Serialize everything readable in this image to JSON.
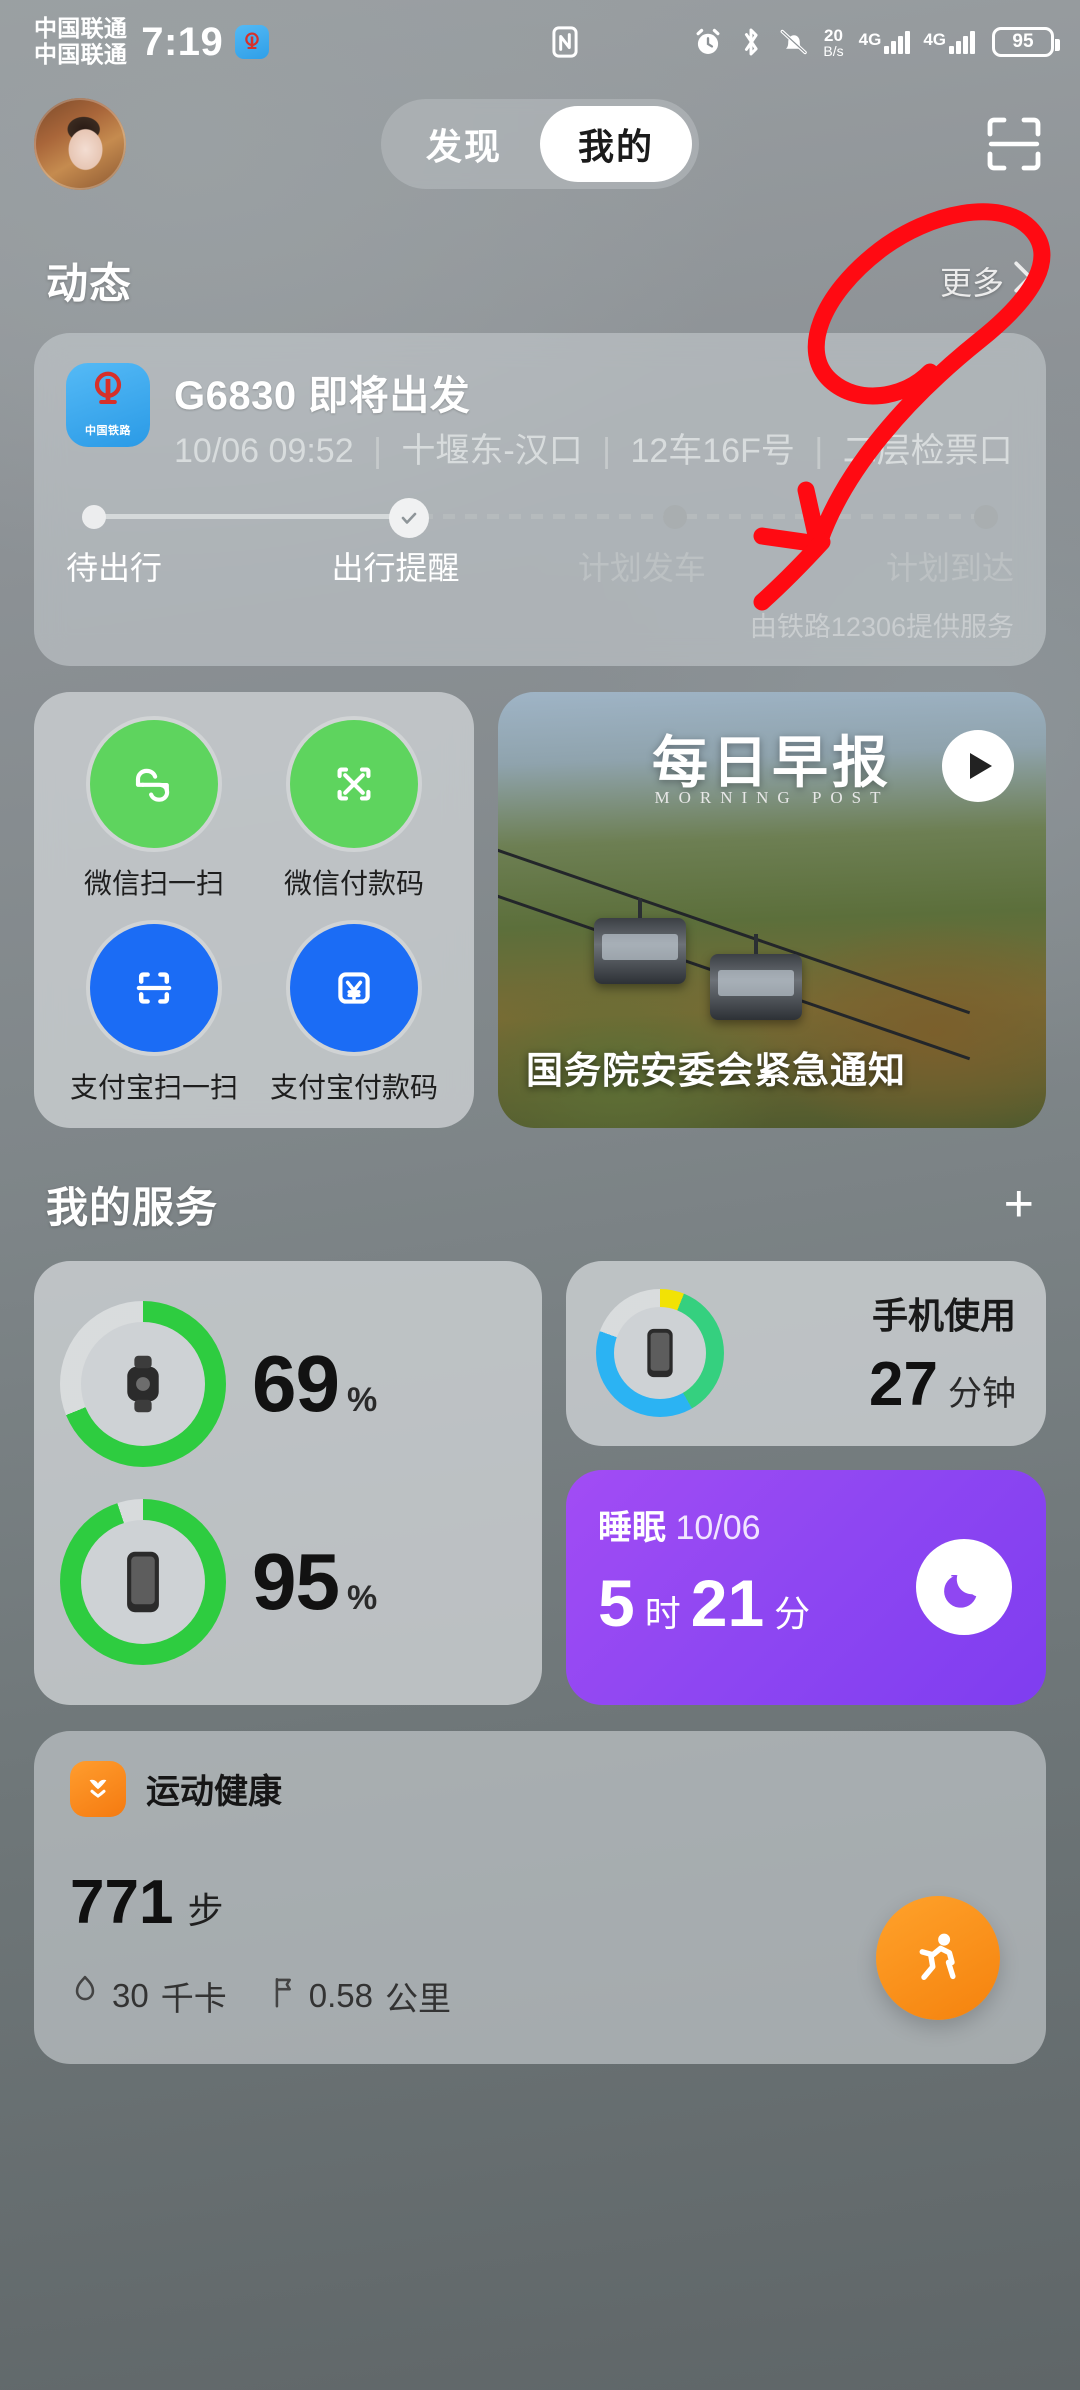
{
  "status_bar": {
    "carrier_line1": "中国联通",
    "carrier_line2": "中国联通",
    "time": "7:19",
    "app_badge_icon": "railway-12306-icon",
    "nfc_icon": "nfc-icon",
    "alarm_icon": "alarm-icon",
    "bluetooth_icon": "bluetooth-icon",
    "mute_icon": "bell-muted-icon",
    "net_speed_value": "20",
    "net_speed_unit": "B/s",
    "network_1": "4G",
    "network_2": "4G",
    "battery_level": "95"
  },
  "top_bar": {
    "avatar_name": "user-avatar",
    "tabs": [
      {
        "label": "发现",
        "active": false
      },
      {
        "label": "我的",
        "active": true
      }
    ],
    "scan_button_icon": "scan-frame-icon"
  },
  "activity": {
    "title": "动态",
    "more_label": "更多",
    "more_chevron": "chevron-right-icon"
  },
  "train_card": {
    "app_icon": "railway-12306-icon",
    "app_icon_caption": "中国铁路",
    "title": "G6830 即将出发",
    "datetime": "10/06 09:52",
    "route": "十堰东-汉口",
    "seat": "12车16F号",
    "gate": "二层检票口",
    "separator": "|",
    "timeline": [
      {
        "label": "待出行",
        "state": "done"
      },
      {
        "label": "出行提醒",
        "state": "current"
      },
      {
        "label": "计划发车",
        "state": "pending"
      },
      {
        "label": "计划到达",
        "state": "pending"
      }
    ],
    "provider": "由铁路12306提供服务"
  },
  "shortcuts": [
    {
      "label": "微信扫一扫",
      "icon": "wechat-scan-icon",
      "color": "#5ED45E"
    },
    {
      "label": "微信付款码",
      "icon": "wechat-payment-code-icon",
      "color": "#5ED45E"
    },
    {
      "label": "支付宝扫一扫",
      "icon": "alipay-scan-icon",
      "color": "#1B6CF5"
    },
    {
      "label": "支付宝付款码",
      "icon": "alipay-payment-code-icon",
      "color": "#1B6CF5"
    }
  ],
  "news_card": {
    "masthead": "每日早报",
    "masthead_sub": "MORNING POST",
    "headline": "国务院安委会紧急通知",
    "play_icon": "play-icon"
  },
  "services": {
    "title": "我的服务",
    "add_icon": "plus-icon",
    "battery_rings": [
      {
        "device": "watch-icon",
        "value": "69",
        "unit": "%",
        "percent": 69,
        "color": "#2ECC40"
      },
      {
        "device": "phone-icon",
        "value": "95",
        "unit": "%",
        "percent": 95,
        "color": "#2ECC40"
      }
    ],
    "phone_usage": {
      "title": "手机使用",
      "value": "27",
      "unit": "分钟",
      "icon": "phone-icon",
      "ring_colors": [
        "#35D07F",
        "#2BB3F3",
        "#F2E205"
      ]
    },
    "sleep": {
      "label": "睡眠",
      "date": "10/06",
      "hours": "5",
      "hours_unit": "时",
      "minutes": "21",
      "minutes_unit": "分",
      "badge_icon": "sleep-moon-icon",
      "color": "#8F47F2"
    }
  },
  "health_card": {
    "app_icon": "huawei-health-icon",
    "app_name": "运动健康",
    "steps_value": "771",
    "steps_unit": "步",
    "calories_icon": "flame-icon",
    "calories_value": "30",
    "calories_unit": "千卡",
    "distance_icon": "flag-icon",
    "distance_value": "0.58",
    "distance_unit": "公里",
    "fab_icon": "running-person-icon"
  },
  "annotation": {
    "shape": "red-hand-drawn-arrow",
    "color": "#FF0A12",
    "points_to": "更多"
  }
}
